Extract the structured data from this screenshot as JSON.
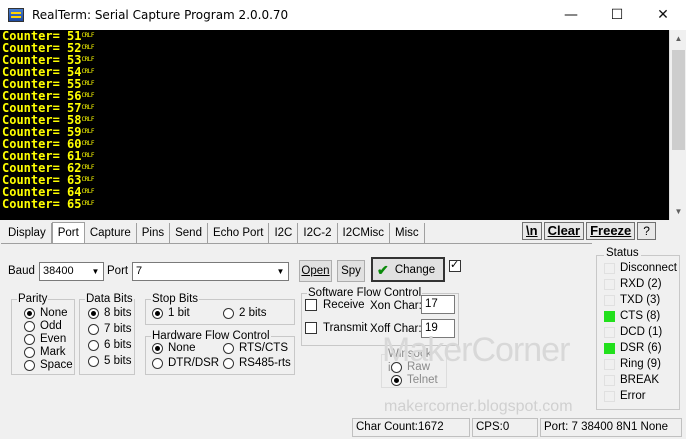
{
  "window": {
    "title": "RealTerm: Serial Capture Program 2.0.0.70",
    "minimize": "—",
    "maximize": "☐",
    "close": "✕"
  },
  "terminal": {
    "lines": [
      "Counter= 51",
      "Counter= 52",
      "Counter= 53",
      "Counter= 54",
      "Counter= 55",
      "Counter= 56",
      "Counter= 57",
      "Counter= 58",
      "Counter= 59",
      "Counter= 60",
      "Counter= 61",
      "Counter= 62",
      "Counter= 63",
      "Counter= 64",
      "Counter= 65"
    ],
    "line_end": "CRLF",
    "colors": {
      "background": "#000000",
      "text": "#ffff00"
    }
  },
  "tabs": [
    "Display",
    "Port",
    "Capture",
    "Pins",
    "Send",
    "Echo Port",
    "I2C",
    "I2C-2",
    "I2CMisc",
    "Misc"
  ],
  "active_tab": "Port",
  "toolbar": {
    "newline": "\\n",
    "clear": "Clear",
    "freeze": "Freeze",
    "help": "?"
  },
  "port": {
    "baud_label": "Baud",
    "baud_value": "38400",
    "port_label": "Port",
    "port_value": "7",
    "open": "Open",
    "spy": "Spy",
    "change": "Change",
    "change_checked": true,
    "parity": {
      "title": "Parity",
      "options": [
        "None",
        "Odd",
        "Even",
        "Mark",
        "Space"
      ],
      "selected": "None"
    },
    "data_bits": {
      "title": "Data Bits",
      "options": [
        "8 bits",
        "7 bits",
        "6 bits",
        "5 bits"
      ],
      "selected": "8 bits"
    },
    "stop_bits": {
      "title": "Stop Bits",
      "options": [
        "1 bit",
        "2 bits"
      ],
      "selected": "1 bit"
    },
    "hw_flow": {
      "title": "Hardware Flow Control",
      "options": [
        "None",
        "RTS/CTS",
        "DTR/DSR",
        "RS485-rts"
      ],
      "selected": "None"
    },
    "sw_flow": {
      "title": "Software Flow Control",
      "receive": "Receive",
      "transmit": "Transmit",
      "xon_label": "Xon Char:",
      "xon_value": "17",
      "xoff_label": "Xoff Char:",
      "xoff_value": "19"
    },
    "winsock": {
      "title": "Winsock is:",
      "options": [
        "Raw",
        "Telnet"
      ],
      "selected": "Telnet"
    }
  },
  "status": {
    "title": "Status",
    "items": [
      {
        "label": "Disconnect",
        "on": false
      },
      {
        "label": "RXD (2)",
        "on": false
      },
      {
        "label": "TXD (3)",
        "on": false
      },
      {
        "label": "CTS (8)",
        "on": true
      },
      {
        "label": "DCD (1)",
        "on": false
      },
      {
        "label": "DSR (6)",
        "on": true
      },
      {
        "label": "Ring (9)",
        "on": false
      },
      {
        "label": "BREAK",
        "on": false
      },
      {
        "label": "Error",
        "on": false
      }
    ],
    "led_on_color": "#22e01c"
  },
  "statusbar": {
    "char_count": "Char Count:1672",
    "cps": "CPS:0",
    "port_info": "Port: 7 38400 8N1 None"
  },
  "watermark": {
    "text": "MakerCorner",
    "url": "makercorner.blogspot.com"
  }
}
